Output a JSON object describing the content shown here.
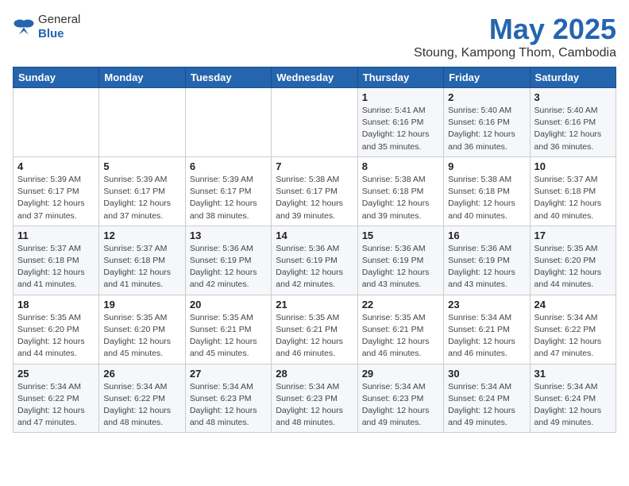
{
  "logo": {
    "general": "General",
    "blue": "Blue"
  },
  "header": {
    "month": "May 2025",
    "location": "Stoung, Kampong Thom, Cambodia"
  },
  "weekdays": [
    "Sunday",
    "Monday",
    "Tuesday",
    "Wednesday",
    "Thursday",
    "Friday",
    "Saturday"
  ],
  "weeks": [
    [
      {
        "day": "",
        "info": ""
      },
      {
        "day": "",
        "info": ""
      },
      {
        "day": "",
        "info": ""
      },
      {
        "day": "",
        "info": ""
      },
      {
        "day": "1",
        "info": "Sunrise: 5:41 AM\nSunset: 6:16 PM\nDaylight: 12 hours\nand 35 minutes."
      },
      {
        "day": "2",
        "info": "Sunrise: 5:40 AM\nSunset: 6:16 PM\nDaylight: 12 hours\nand 36 minutes."
      },
      {
        "day": "3",
        "info": "Sunrise: 5:40 AM\nSunset: 6:16 PM\nDaylight: 12 hours\nand 36 minutes."
      }
    ],
    [
      {
        "day": "4",
        "info": "Sunrise: 5:39 AM\nSunset: 6:17 PM\nDaylight: 12 hours\nand 37 minutes."
      },
      {
        "day": "5",
        "info": "Sunrise: 5:39 AM\nSunset: 6:17 PM\nDaylight: 12 hours\nand 37 minutes."
      },
      {
        "day": "6",
        "info": "Sunrise: 5:39 AM\nSunset: 6:17 PM\nDaylight: 12 hours\nand 38 minutes."
      },
      {
        "day": "7",
        "info": "Sunrise: 5:38 AM\nSunset: 6:17 PM\nDaylight: 12 hours\nand 39 minutes."
      },
      {
        "day": "8",
        "info": "Sunrise: 5:38 AM\nSunset: 6:18 PM\nDaylight: 12 hours\nand 39 minutes."
      },
      {
        "day": "9",
        "info": "Sunrise: 5:38 AM\nSunset: 6:18 PM\nDaylight: 12 hours\nand 40 minutes."
      },
      {
        "day": "10",
        "info": "Sunrise: 5:37 AM\nSunset: 6:18 PM\nDaylight: 12 hours\nand 40 minutes."
      }
    ],
    [
      {
        "day": "11",
        "info": "Sunrise: 5:37 AM\nSunset: 6:18 PM\nDaylight: 12 hours\nand 41 minutes."
      },
      {
        "day": "12",
        "info": "Sunrise: 5:37 AM\nSunset: 6:18 PM\nDaylight: 12 hours\nand 41 minutes."
      },
      {
        "day": "13",
        "info": "Sunrise: 5:36 AM\nSunset: 6:19 PM\nDaylight: 12 hours\nand 42 minutes."
      },
      {
        "day": "14",
        "info": "Sunrise: 5:36 AM\nSunset: 6:19 PM\nDaylight: 12 hours\nand 42 minutes."
      },
      {
        "day": "15",
        "info": "Sunrise: 5:36 AM\nSunset: 6:19 PM\nDaylight: 12 hours\nand 43 minutes."
      },
      {
        "day": "16",
        "info": "Sunrise: 5:36 AM\nSunset: 6:19 PM\nDaylight: 12 hours\nand 43 minutes."
      },
      {
        "day": "17",
        "info": "Sunrise: 5:35 AM\nSunset: 6:20 PM\nDaylight: 12 hours\nand 44 minutes."
      }
    ],
    [
      {
        "day": "18",
        "info": "Sunrise: 5:35 AM\nSunset: 6:20 PM\nDaylight: 12 hours\nand 44 minutes."
      },
      {
        "day": "19",
        "info": "Sunrise: 5:35 AM\nSunset: 6:20 PM\nDaylight: 12 hours\nand 45 minutes."
      },
      {
        "day": "20",
        "info": "Sunrise: 5:35 AM\nSunset: 6:21 PM\nDaylight: 12 hours\nand 45 minutes."
      },
      {
        "day": "21",
        "info": "Sunrise: 5:35 AM\nSunset: 6:21 PM\nDaylight: 12 hours\nand 46 minutes."
      },
      {
        "day": "22",
        "info": "Sunrise: 5:35 AM\nSunset: 6:21 PM\nDaylight: 12 hours\nand 46 minutes."
      },
      {
        "day": "23",
        "info": "Sunrise: 5:34 AM\nSunset: 6:21 PM\nDaylight: 12 hours\nand 46 minutes."
      },
      {
        "day": "24",
        "info": "Sunrise: 5:34 AM\nSunset: 6:22 PM\nDaylight: 12 hours\nand 47 minutes."
      }
    ],
    [
      {
        "day": "25",
        "info": "Sunrise: 5:34 AM\nSunset: 6:22 PM\nDaylight: 12 hours\nand 47 minutes."
      },
      {
        "day": "26",
        "info": "Sunrise: 5:34 AM\nSunset: 6:22 PM\nDaylight: 12 hours\nand 48 minutes."
      },
      {
        "day": "27",
        "info": "Sunrise: 5:34 AM\nSunset: 6:23 PM\nDaylight: 12 hours\nand 48 minutes."
      },
      {
        "day": "28",
        "info": "Sunrise: 5:34 AM\nSunset: 6:23 PM\nDaylight: 12 hours\nand 48 minutes."
      },
      {
        "day": "29",
        "info": "Sunrise: 5:34 AM\nSunset: 6:23 PM\nDaylight: 12 hours\nand 49 minutes."
      },
      {
        "day": "30",
        "info": "Sunrise: 5:34 AM\nSunset: 6:24 PM\nDaylight: 12 hours\nand 49 minutes."
      },
      {
        "day": "31",
        "info": "Sunrise: 5:34 AM\nSunset: 6:24 PM\nDaylight: 12 hours\nand 49 minutes."
      }
    ]
  ]
}
